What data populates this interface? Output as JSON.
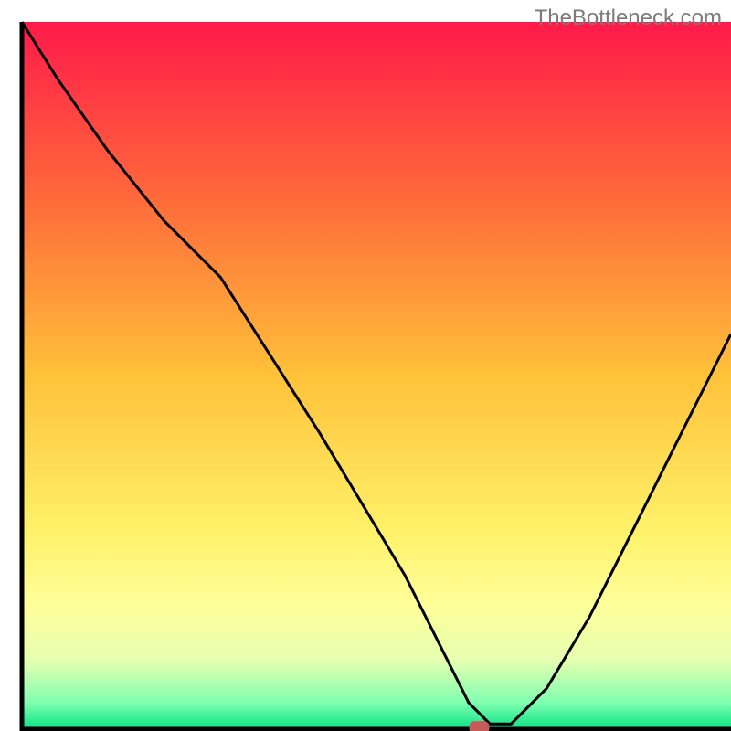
{
  "watermark": "TheBottleneck.com",
  "chart_data": {
    "type": "line",
    "title": "",
    "xlabel": "",
    "ylabel": "",
    "xlim": [
      0,
      100
    ],
    "ylim": [
      0,
      100
    ],
    "background_gradient_stops": [
      {
        "offset": 0,
        "color": "#ff1a4a"
      },
      {
        "offset": 25,
        "color": "#ff6a3a"
      },
      {
        "offset": 50,
        "color": "#ffc23a"
      },
      {
        "offset": 72,
        "color": "#fff26a"
      },
      {
        "offset": 82,
        "color": "#ffff99"
      },
      {
        "offset": 90,
        "color": "#e6ffb0"
      },
      {
        "offset": 96,
        "color": "#80ffb0"
      },
      {
        "offset": 100,
        "color": "#00e080"
      }
    ],
    "series": [
      {
        "name": "bottleneck-curve",
        "x": [
          0,
          5,
          12,
          20,
          28,
          35,
          42,
          48,
          54,
          58,
          61,
          63,
          66,
          69,
          74,
          80,
          86,
          92,
          98,
          100
        ],
        "y": [
          100,
          92,
          82,
          72,
          64,
          53,
          42,
          32,
          22,
          14,
          8,
          4,
          1,
          1,
          6,
          16,
          28,
          40,
          52,
          56
        ]
      }
    ],
    "marker": {
      "name": "optimal-point",
      "x": 64.5,
      "y": 0.5,
      "color": "#c95a5a"
    },
    "axes": {
      "left": {
        "x": 3,
        "y0": 3,
        "y1": 100
      },
      "bottom": {
        "y": 100,
        "x0": 3,
        "x1": 100
      }
    }
  }
}
